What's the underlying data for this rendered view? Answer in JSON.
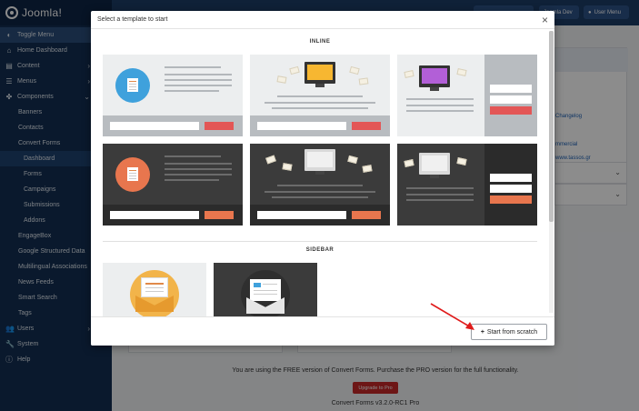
{
  "sidebar": {
    "logo": "Joomla!",
    "items": [
      {
        "icon": "toggle-icon",
        "glyph": "◐",
        "label": "Toggle Menu"
      },
      {
        "icon": "home-icon",
        "glyph": "⌂",
        "label": "Home Dashboard"
      },
      {
        "icon": "content-icon",
        "glyph": "▤",
        "label": "Content"
      },
      {
        "icon": "menus-icon",
        "glyph": "☰",
        "label": "Menus"
      },
      {
        "icon": "components-icon",
        "glyph": "✤",
        "label": "Components"
      },
      {
        "label": "Banners"
      },
      {
        "label": "Contacts"
      },
      {
        "label": "Convert Forms"
      },
      {
        "label": "Dashboard"
      },
      {
        "label": "Forms"
      },
      {
        "label": "Campaigns"
      },
      {
        "label": "Submissions"
      },
      {
        "label": "Addons"
      },
      {
        "label": "EngageBox"
      },
      {
        "label": "Google Structured Data"
      },
      {
        "label": "Multilingual Associations"
      },
      {
        "label": "News Feeds"
      },
      {
        "label": "Smart Search"
      },
      {
        "label": "Tags"
      },
      {
        "icon": "users-icon",
        "glyph": "👥",
        "label": "Users"
      },
      {
        "icon": "system-icon",
        "glyph": "🔧",
        "label": "System"
      },
      {
        "icon": "help-icon",
        "glyph": "ⓘ",
        "label": "Help"
      }
    ]
  },
  "topbar": {
    "user_menu": "User Menu",
    "joomla_dev": "Joomla Dev"
  },
  "background": {
    "changelog": "Changelog",
    "commercial": "mmercial",
    "tassos": "www.tassos.gr",
    "footer_text": "You are using the FREE version of Convert Forms. Purchase the PRO version for the full functionality.",
    "upgrade_label": "Upgrade to Pro",
    "version": "Convert Forms v3.2.0-RC1 Pro"
  },
  "modal": {
    "title": "Select a template to start",
    "close_glyph": "×",
    "inline_heading": "INLINE",
    "sidebar_heading": "SIDEBAR",
    "start_scratch_label": "Start from scratch",
    "plus_glyph": "+"
  },
  "colors": {
    "sidebar": "#132f53",
    "accent_red": "#e35656",
    "accent_orange": "#e8764e",
    "blue_circle": "#3fa1dc",
    "orange_circle": "#e8764e",
    "upgrade": "#c62828"
  }
}
